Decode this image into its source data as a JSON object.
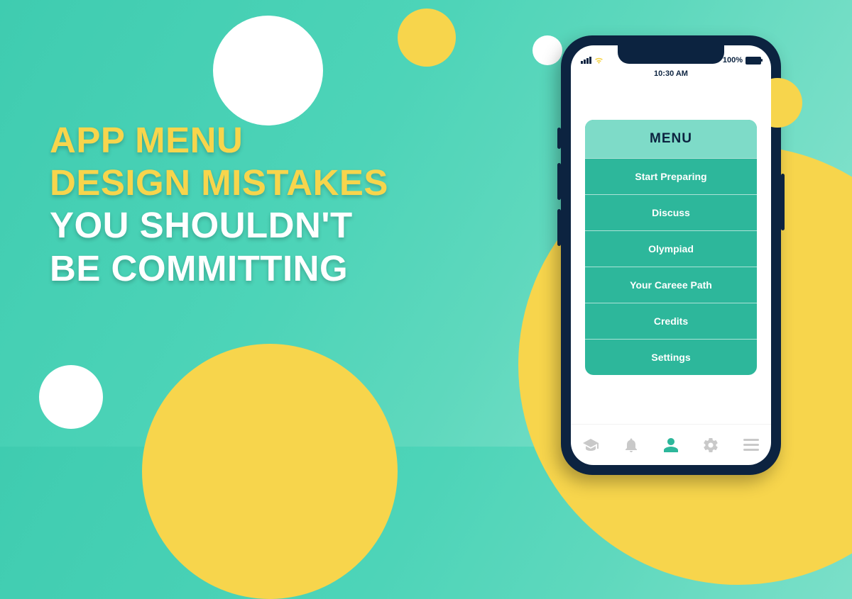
{
  "headline": {
    "line1": "APP MENU",
    "line2": "DESIGN MISTAKES",
    "line3": "YOU SHOULDN'T",
    "line4": "BE COMMITTING"
  },
  "status": {
    "time": "10:30 AM",
    "battery_pct": "100%"
  },
  "menu": {
    "title": "MENU",
    "items": [
      "Start Preparing",
      "Discuss",
      "Olympiad",
      "Your Careee Path",
      "Credits",
      "Settings"
    ]
  },
  "colors": {
    "accent_yellow": "#f7d54c",
    "teal": "#2db79b",
    "teal_light": "#7edbc8",
    "navy": "#0c2340"
  }
}
